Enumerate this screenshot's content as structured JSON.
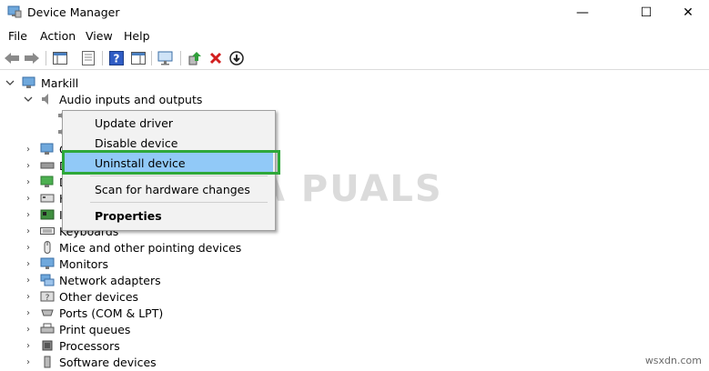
{
  "window": {
    "title": "Device Manager",
    "minimize": "—",
    "maximize": "☐",
    "close": "✕"
  },
  "menu": [
    "File",
    "Action",
    "View",
    "Help"
  ],
  "tree": {
    "root": "Markill",
    "audio": "Audio inputs and outputs",
    "categories": [
      "C",
      "D",
      "D",
      "H",
      "I",
      "Keyboards",
      "Mice and other pointing devices",
      "Monitors",
      "Network adapters",
      "Other devices",
      "Ports (COM & LPT)",
      "Print queues",
      "Processors",
      "Software devices"
    ]
  },
  "context_menu": {
    "items": [
      "Update driver",
      "Disable device",
      "Uninstall device",
      "Scan for hardware changes",
      "Properties"
    ],
    "highlighted": "Uninstall device"
  },
  "watermark": {
    "logo": "A PUALS",
    "site": "wsxdn.com"
  },
  "colors": {
    "highlight": "#91c9f7",
    "green_box": "#2ea83a",
    "close_x": "#d21f1f"
  }
}
